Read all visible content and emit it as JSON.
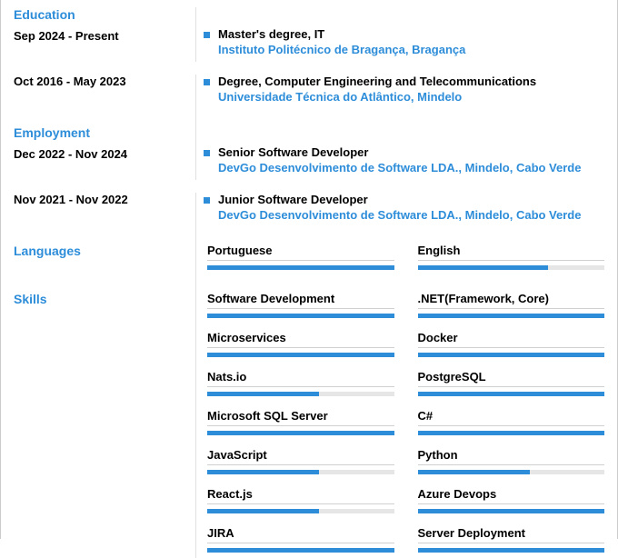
{
  "sections": {
    "education": {
      "title": "Education",
      "entries": [
        {
          "dates": "Sep 2024 - Present",
          "title": "Master's degree, IT",
          "sub": "Instituto Politécnico de Bragança, Bragança"
        },
        {
          "dates": "Oct 2016 - May 2023",
          "title": "Degree, Computer Engineering and Telecommunications",
          "sub": "Universidade Técnica do Atlântico, Mindelo"
        }
      ]
    },
    "employment": {
      "title": "Employment",
      "entries": [
        {
          "dates": "Dec 2022 - Nov 2024",
          "title": "Senior Software Developer",
          "sub": "DevGo Desenvolvimento de Software LDA., Mindelo, Cabo Verde"
        },
        {
          "dates": "Nov 2021 - Nov 2022",
          "title": "Junior Software Developer",
          "sub": "DevGo Desenvolvimento de Software LDA., Mindelo, Cabo Verde"
        }
      ]
    },
    "languages": {
      "title": "Languages",
      "items": [
        {
          "name": "Portuguese",
          "level": 100
        },
        {
          "name": "English",
          "level": 70
        }
      ]
    },
    "skills": {
      "title": "Skills",
      "items": [
        {
          "name": "Software Development",
          "level": 100
        },
        {
          "name": ".NET(Framework, Core)",
          "level": 100
        },
        {
          "name": "Microservices",
          "level": 100
        },
        {
          "name": "Docker",
          "level": 100
        },
        {
          "name": "Nats.io",
          "level": 60
        },
        {
          "name": "PostgreSQL",
          "level": 100
        },
        {
          "name": "Microsoft SQL Server",
          "level": 100
        },
        {
          "name": "C#",
          "level": 100
        },
        {
          "name": "JavaScript",
          "level": 60
        },
        {
          "name": "Python",
          "level": 60
        },
        {
          "name": "React.js",
          "level": 60
        },
        {
          "name": "Azure Devops",
          "level": 100
        },
        {
          "name": "JIRA",
          "level": 100
        },
        {
          "name": "Server Deployment",
          "level": 100
        }
      ]
    }
  }
}
